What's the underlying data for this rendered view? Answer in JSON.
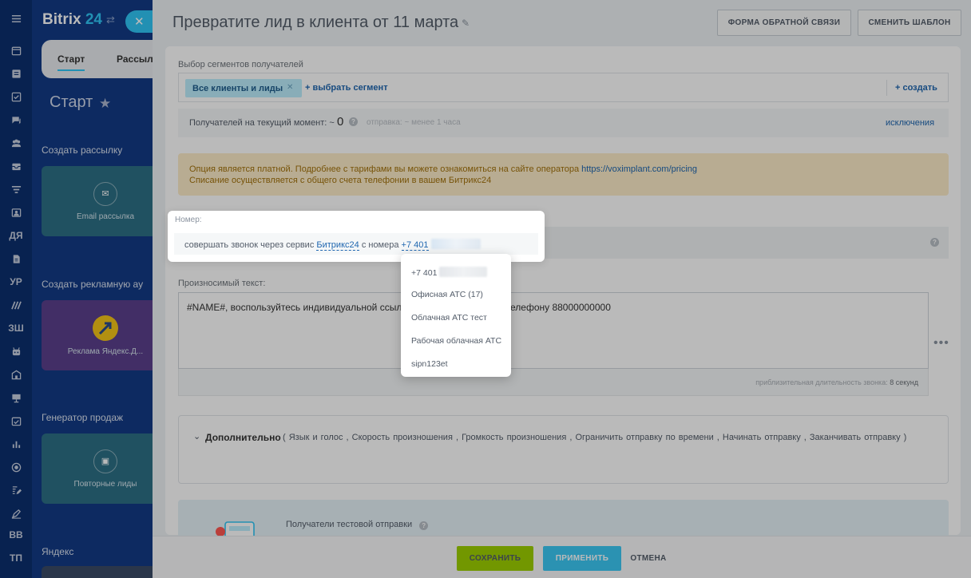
{
  "rail": {
    "items": [
      "menu-icon",
      "calendar-icon",
      "list-icon",
      "tasks-icon",
      "chat-icon",
      "users-icon",
      "inbox-icon",
      "filter-icon",
      "contact-icon",
      "ДЯ",
      "document-icon",
      "УР",
      "marketing-icon",
      "ЗШ",
      "robot-icon",
      "building-icon",
      "presentation-icon",
      "calendar-check-icon",
      "chart-icon",
      "target-icon",
      "edit-icon",
      "pen-icon",
      "ВВ",
      "ТП"
    ]
  },
  "sidebar": {
    "brand_text": "Bitrix",
    "brand_num": "24",
    "tab_start": "Старт",
    "tab_mailing": "Рассыл",
    "title": "Старт",
    "sec_create_mailing": "Создать рассылку",
    "card_email": "Email рассылка",
    "sec_create_ad": "Создать рекламную ау",
    "card_yandex": "Реклама Яндекс.Д...",
    "sec_sales_gen": "Генератор продаж",
    "card_repeat": "Повторные лиды",
    "sec_yandex": "Яндекс"
  },
  "panel": {
    "title": "Превратите лид в клиента от 11 марта",
    "btn_feedback": "ФОРМА ОБРАТНОЙ СВЯЗИ",
    "btn_change_template": "СМЕНИТЬ ШАБЛОН",
    "segments_label": "Выбор сегментов получателей",
    "segment_tag": "Все клиенты и лиды",
    "choose_segment": "+ выбрать сегмент",
    "create": "+ создать",
    "recipients_label": "Получателей на текущий момент: ~",
    "recipients_count": "0",
    "send_time": "отправка: ~ менее 1 часа",
    "exclusions": "исключения",
    "alert_line1": "Опция является платной. Подробнее с тарифами вы можете ознакомиться на сайте оператора",
    "alert_link": "https://voximplant.com/pricing",
    "alert_line2": "Списание осуществляется с общего счета телефонии в вашем Битрикс24",
    "number_label": "Номер:",
    "call_text_1": "совершать звонок через сервис",
    "call_service": "Битрикс24",
    "call_text_2": "с номера",
    "call_number": "+7 401",
    "speech_label": "Произносимый текст:",
    "speech_text_left": "#NAME#, воспользуйтесь индивидуальной ссылко",
    "speech_text_right": "елефону 88000000000",
    "duration_label": "приблизительная длительность звонка:",
    "duration_value": "8 секунд",
    "extra_title": "Дополнительно",
    "extra_options": "( Язык и голос ,  Скорость произношения ,  Громкость произношения ,  Ограничить отправку по времени ,  Начинать отправку ,  Заканчивать отправку )",
    "test_recipients": "Получатели тестовой отправки"
  },
  "dropdown": {
    "items": [
      "+7 401",
      "Офисная АТС (17)",
      "Облачная АТС тест",
      "Рабочая облачная АТС",
      "sipn123et"
    ]
  },
  "footer": {
    "save": "СОХРАНИТЬ",
    "apply": "ПРИМЕНИТЬ",
    "cancel": "ОТМЕНА"
  },
  "colors": {
    "save": "#9dcf00",
    "apply": "#3bc8f5",
    "link": "#2067b0",
    "alert_bg": "#fcecc8"
  }
}
